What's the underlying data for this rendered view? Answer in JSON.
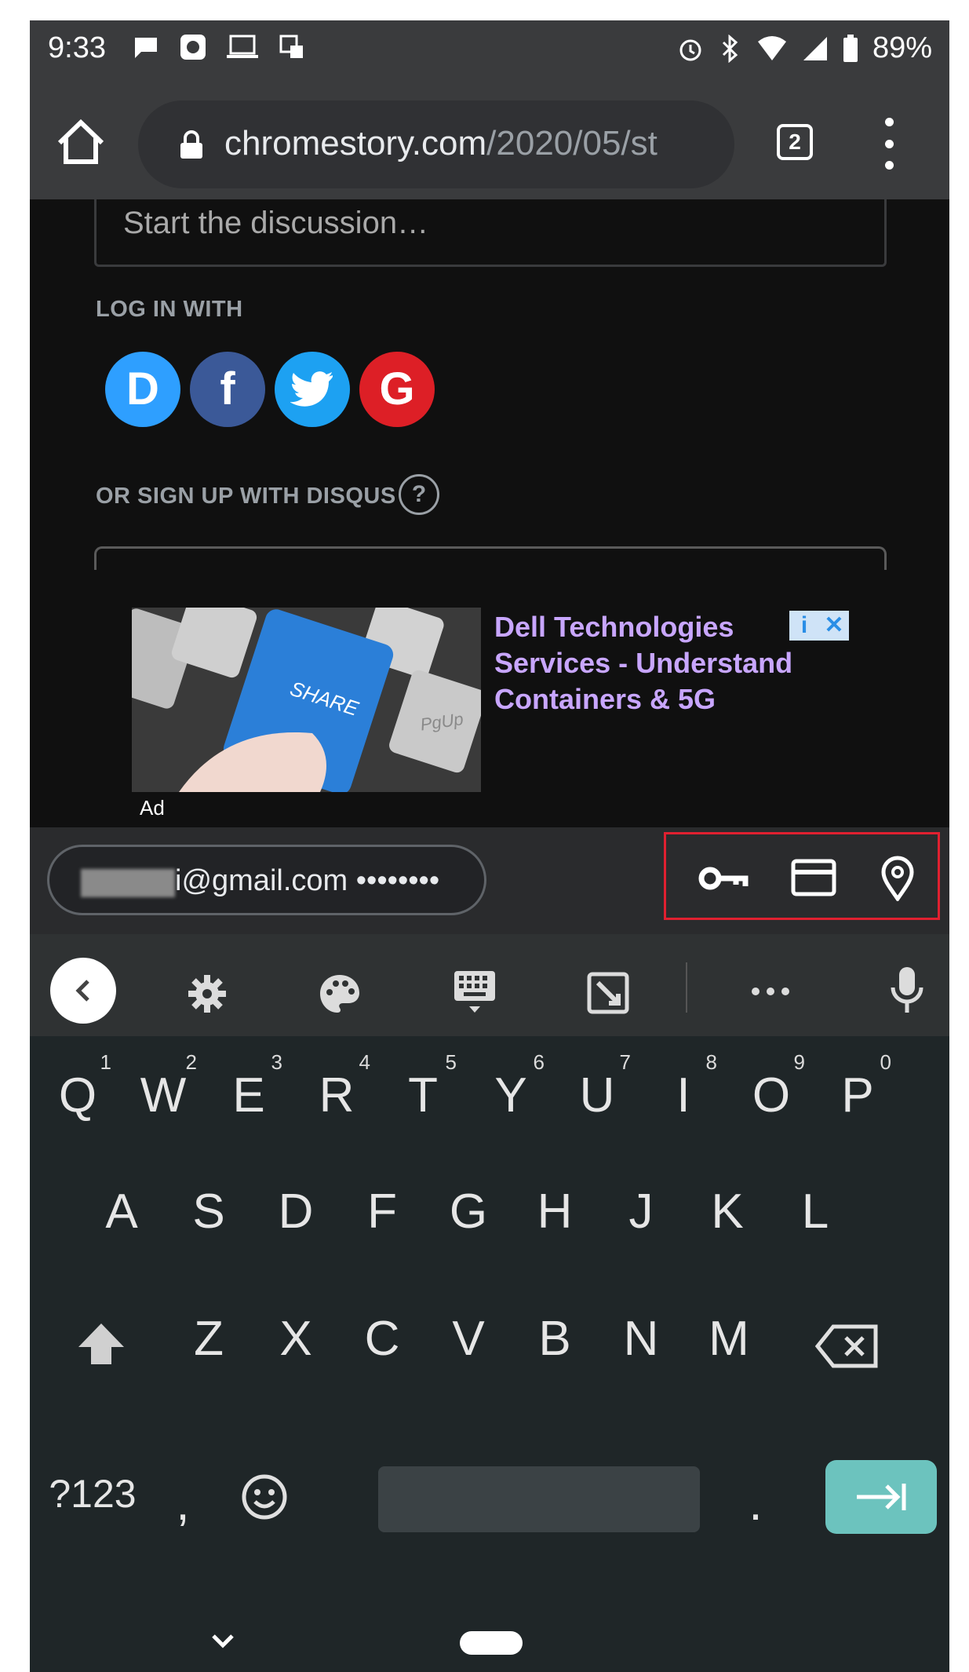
{
  "status_bar": {
    "time": "9:33",
    "battery": "89%",
    "left_icons": [
      "message-icon",
      "app-icon",
      "laptop-icon",
      "screenshot-icon"
    ],
    "right_icons": [
      "alarm-icon",
      "bluetooth-icon",
      "wifi-icon",
      "signal-icon",
      "battery-icon"
    ]
  },
  "toolbar": {
    "url_domain": "chromestory.com",
    "url_path": "/2020/05/st",
    "tab_count": "2"
  },
  "page": {
    "discussion_placeholder": "Start the discussion…",
    "login_label": "LOG IN WITH",
    "social": [
      {
        "name": "disqus",
        "letter": "D",
        "color": "#2e9fff"
      },
      {
        "name": "facebook",
        "letter": "f",
        "color": "#3b5998"
      },
      {
        "name": "twitter",
        "letter": "",
        "color": "#1da1f2"
      },
      {
        "name": "google",
        "letter": "G",
        "color": "#dd1f26"
      }
    ],
    "signup_label": "OR SIGN UP WITH DISQUS",
    "help": "?"
  },
  "ad": {
    "image_key_text": "SHARE",
    "image_key2": "PgUp",
    "text": "Dell Technologies Services - Understand Containers & 5G",
    "label": "Ad",
    "choices_info": "i",
    "choices_close": "✕"
  },
  "autofill": {
    "email_suffix": "i@gmail.com",
    "password_mask": "••••••••",
    "icons": [
      "key-icon",
      "credit-card-icon",
      "location-pin-icon"
    ],
    "highlight_color": "#e02030"
  },
  "keyboard": {
    "row1": [
      {
        "k": "Q",
        "n": "1"
      },
      {
        "k": "W",
        "n": "2"
      },
      {
        "k": "E",
        "n": "3"
      },
      {
        "k": "R",
        "n": "4"
      },
      {
        "k": "T",
        "n": "5"
      },
      {
        "k": "Y",
        "n": "6"
      },
      {
        "k": "U",
        "n": "7"
      },
      {
        "k": "I",
        "n": "8"
      },
      {
        "k": "O",
        "n": "9"
      },
      {
        "k": "P",
        "n": "0"
      }
    ],
    "row2": [
      "A",
      "S",
      "D",
      "F",
      "G",
      "H",
      "J",
      "K",
      "L"
    ],
    "row3": [
      "Z",
      "X",
      "C",
      "V",
      "B",
      "N",
      "M"
    ],
    "symbols_key": "?123",
    "comma": ",",
    "period": ".",
    "enter_color": "#6cc3be"
  }
}
